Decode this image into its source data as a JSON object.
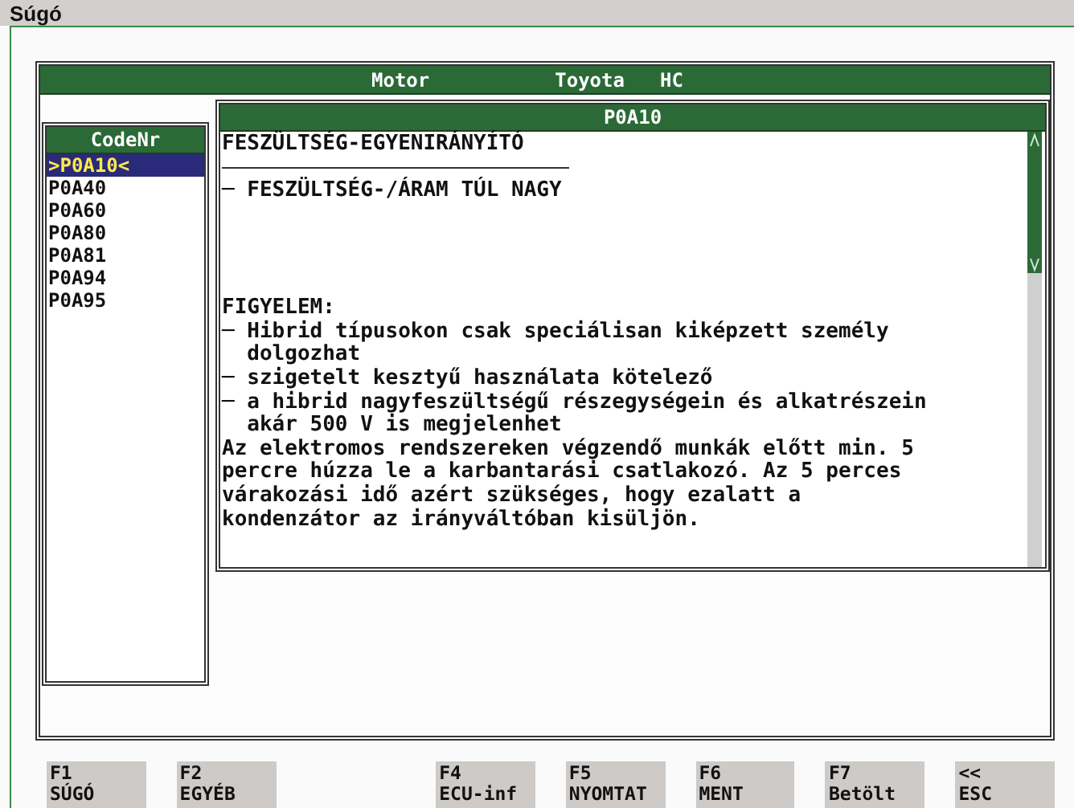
{
  "window": {
    "title": "Súgó"
  },
  "header": {
    "system": "Motor",
    "make": "Toyota",
    "engine": "HC"
  },
  "code_list": {
    "title": "CodeNr",
    "items": [
      {
        "label": ">P0A10<",
        "selected": true
      },
      {
        "label": "P0A40",
        "selected": false
      },
      {
        "label": "P0A60",
        "selected": false
      },
      {
        "label": "P0A80",
        "selected": false
      },
      {
        "label": "P0A81",
        "selected": false
      },
      {
        "label": "P0A94",
        "selected": false
      },
      {
        "label": "P0A95",
        "selected": false
      }
    ]
  },
  "detail": {
    "title": "P0A10",
    "heading": "FESZÜLTSÉG-EGYENIRÁNYÍTÓ",
    "symptom": "─ FESZÜLTSÉG-/ÁRAM TÚL NAGY",
    "warning_title": "FIGYELEM:",
    "warnings": [
      "─ Hibrid típusokon csak speciálisan kiképzett személy dolgozhat",
      "─ szigetelt kesztyű használata kötelező",
      "─ a hibrid nagyfeszültségű részegységein és alkatrészein akár 500 V is megjelenhet"
    ],
    "note": "Az elektromos rendszereken végzendő munkák előtt min. 5 percre húzza le a karbantarási csatlakozó. Az 5 perces várakozási idő azért szükséges, hogy ezalatt a kondenzátor az irányváltóban kisüljön."
  },
  "function_keys": [
    {
      "kind": "key",
      "key": "F1",
      "label": "SÚGÓ"
    },
    {
      "kind": "key",
      "key": "F2",
      "label": "EGYÉB"
    },
    {
      "kind": "gap"
    },
    {
      "kind": "key",
      "key": "F4",
      "label": "ECU-inf"
    },
    {
      "kind": "key",
      "key": "F5",
      "label": "NYOMTAT"
    },
    {
      "kind": "key",
      "key": "F6",
      "label": "MENT"
    },
    {
      "kind": "key",
      "key": "F7",
      "label": "Betölt"
    },
    {
      "kind": "key",
      "key": "<<",
      "label": "ESC"
    }
  ]
}
